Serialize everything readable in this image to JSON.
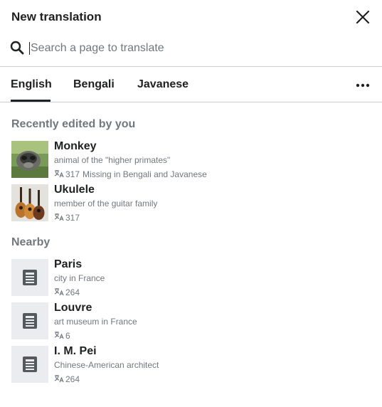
{
  "dialog": {
    "title": "New translation",
    "close_icon": "close-icon"
  },
  "search": {
    "icon": "search-icon",
    "placeholder": "Search a page to translate",
    "value": ""
  },
  "tabs": [
    {
      "label": "English",
      "active": true
    },
    {
      "label": "Bengali",
      "active": false
    },
    {
      "label": "Javanese",
      "active": false
    }
  ],
  "more_icon": "ellipsis-icon",
  "recent": {
    "title": "Recently edited by you",
    "items": [
      {
        "title": "Monkey",
        "description": "animal of the \"higher primates\"",
        "langlinks": "317",
        "missing": "Missing in Bengali and Javanese",
        "thumbnail": "monkey-photo"
      },
      {
        "title": "Ukulele",
        "description": "member of the guitar family",
        "langlinks": "317",
        "thumbnail": "ukulele-photo"
      }
    ]
  },
  "nearby": {
    "title": "Nearby",
    "items": [
      {
        "title": "Paris",
        "description": "city in France",
        "langlinks": "264",
        "thumbnail": "article-placeholder-icon"
      },
      {
        "title": "Louvre",
        "description": "art museum in France",
        "langlinks": "6",
        "thumbnail": "article-placeholder-icon"
      },
      {
        "title": "I. M. Pei",
        "description": "Chinese-American architect",
        "langlinks": "264",
        "thumbnail": "article-placeholder-icon"
      }
    ]
  }
}
